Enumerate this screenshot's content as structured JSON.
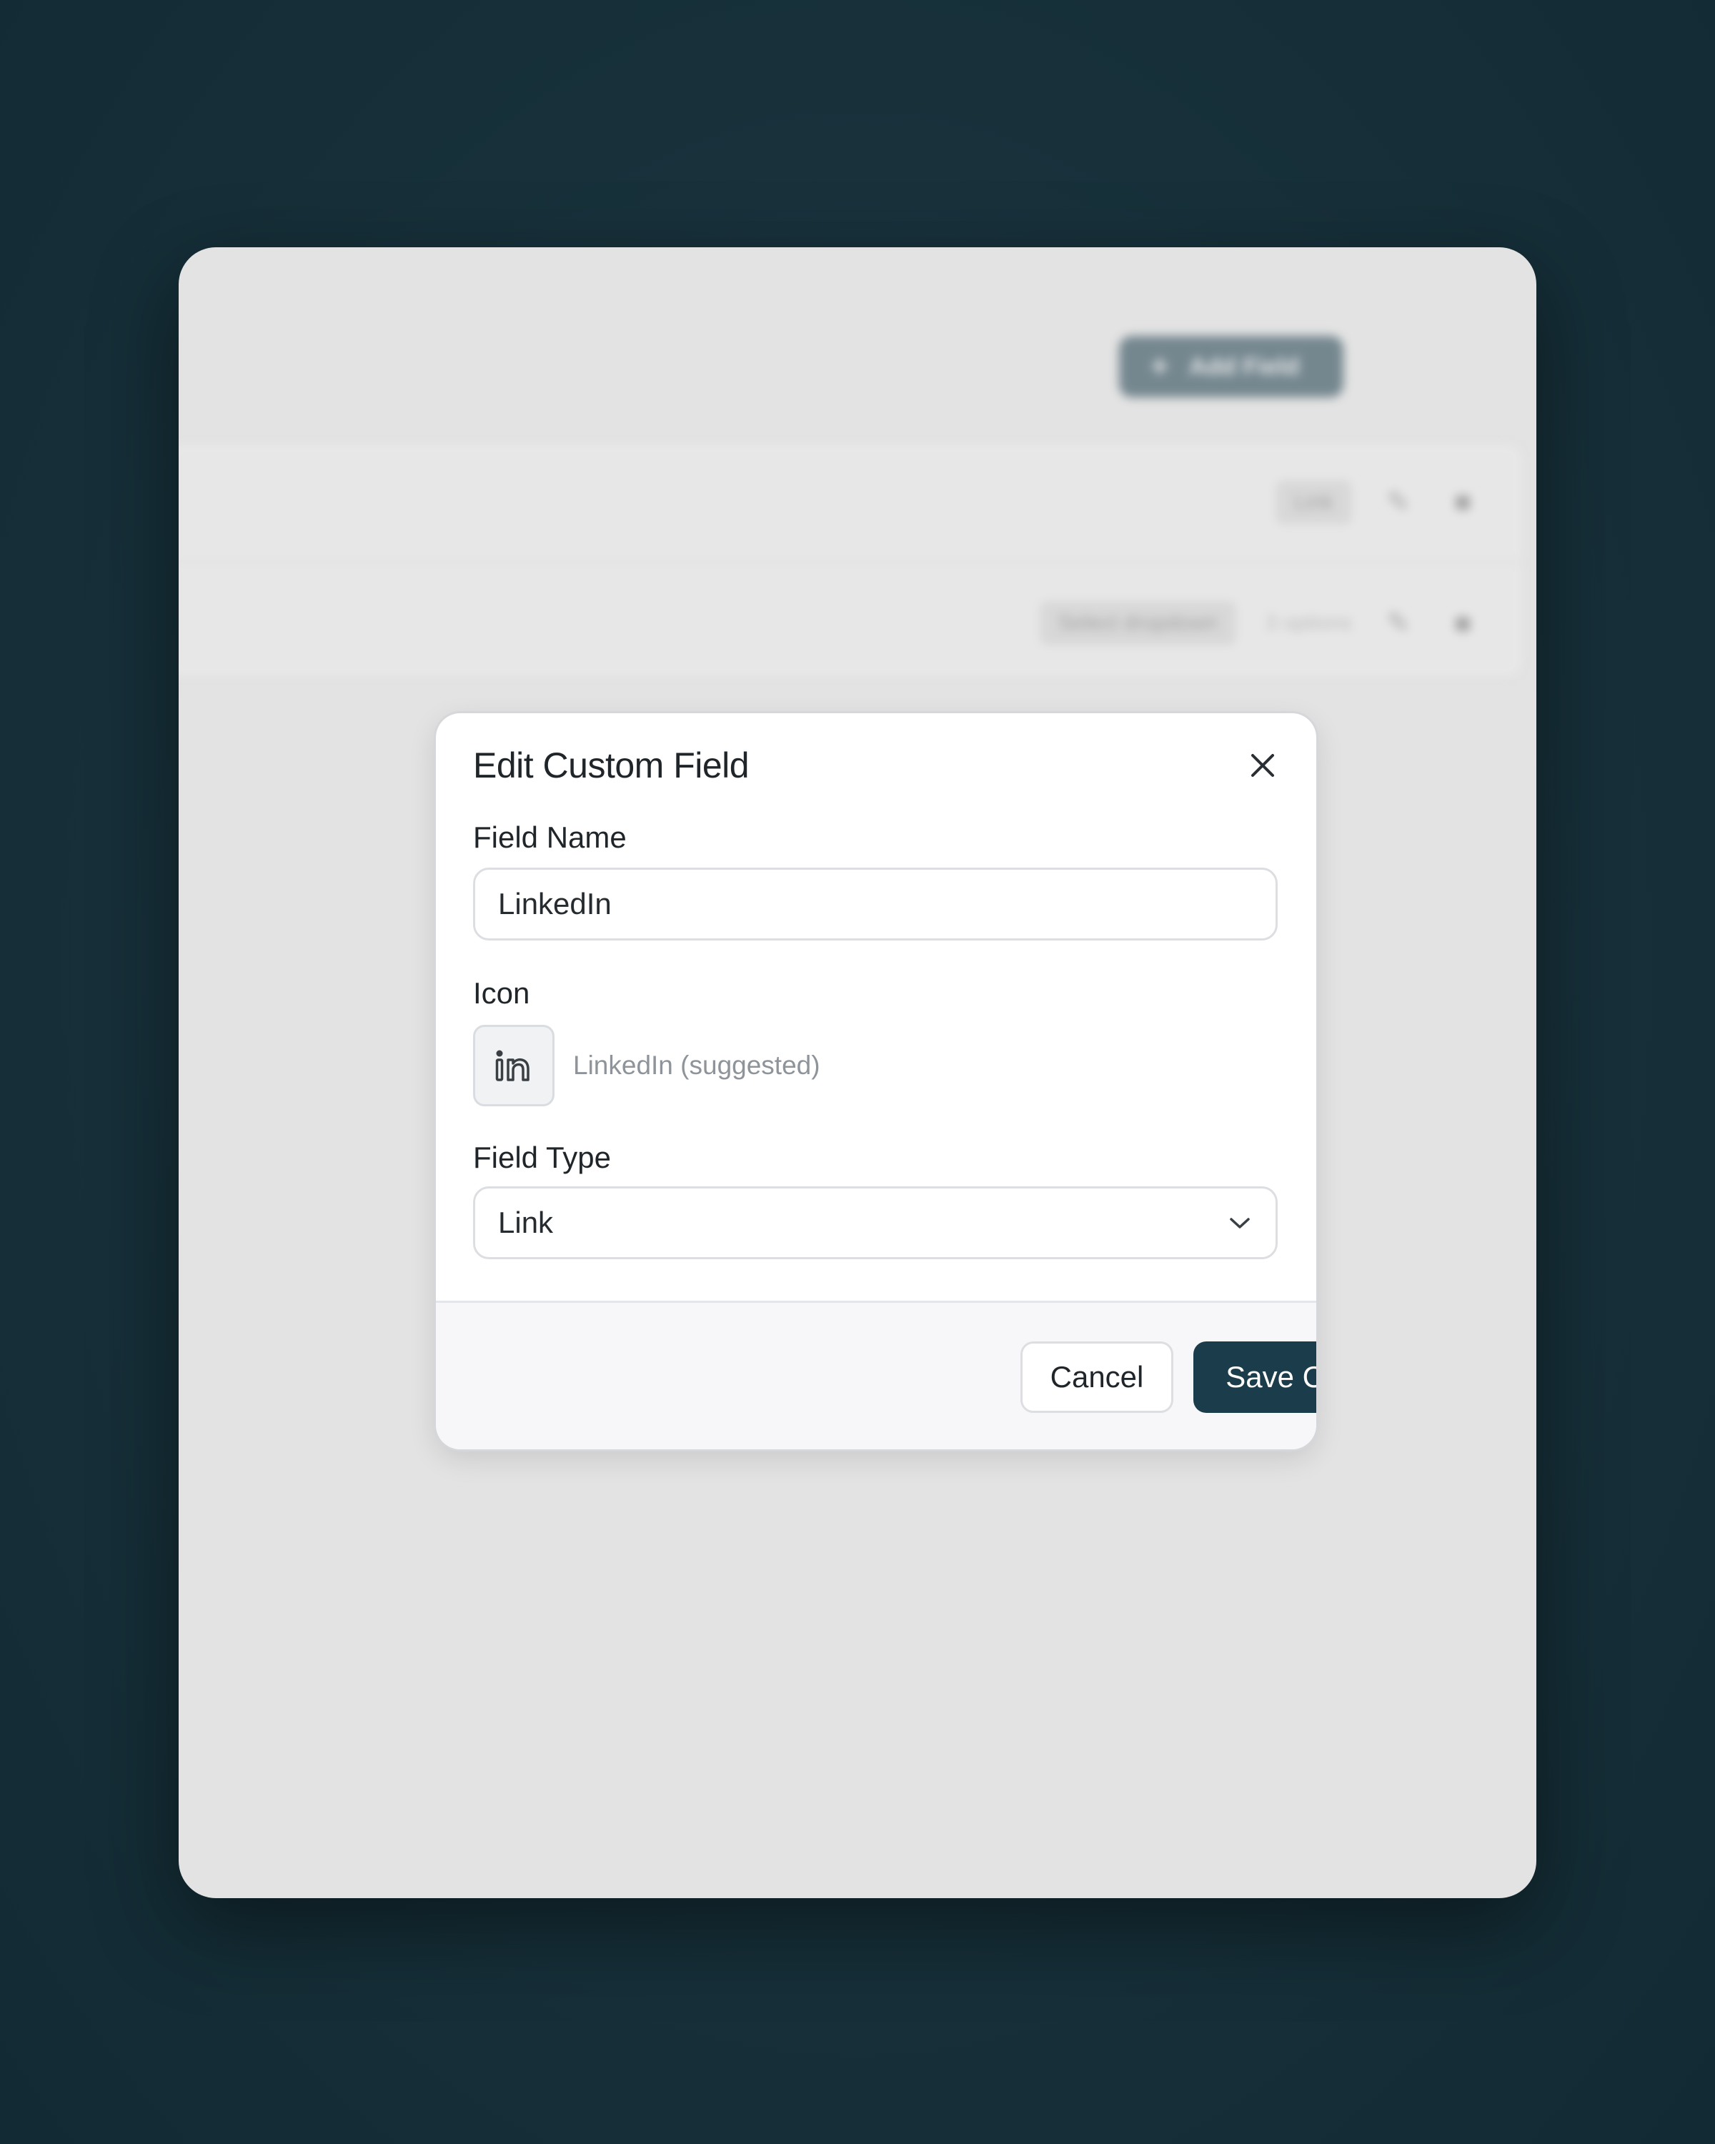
{
  "background": {
    "add_button_label": "Add Field",
    "rows": [
      {
        "type_label": "Link"
      },
      {
        "type_label": "Select dropdown",
        "options_label": "3 options"
      }
    ]
  },
  "dialog": {
    "title": "Edit Custom Field",
    "field_name": {
      "label": "Field Name",
      "value": "LinkedIn"
    },
    "icon": {
      "label": "Icon",
      "name": "linkedin-icon",
      "hint": "LinkedIn (suggested)"
    },
    "field_type": {
      "label": "Field Type",
      "value": "Link"
    },
    "footer": {
      "cancel_label": "Cancel",
      "save_label": "Save Changes"
    }
  },
  "colors": {
    "primary": "#1b3c4b",
    "page_background": "#17303a",
    "window_background": "#e3e3e3"
  }
}
